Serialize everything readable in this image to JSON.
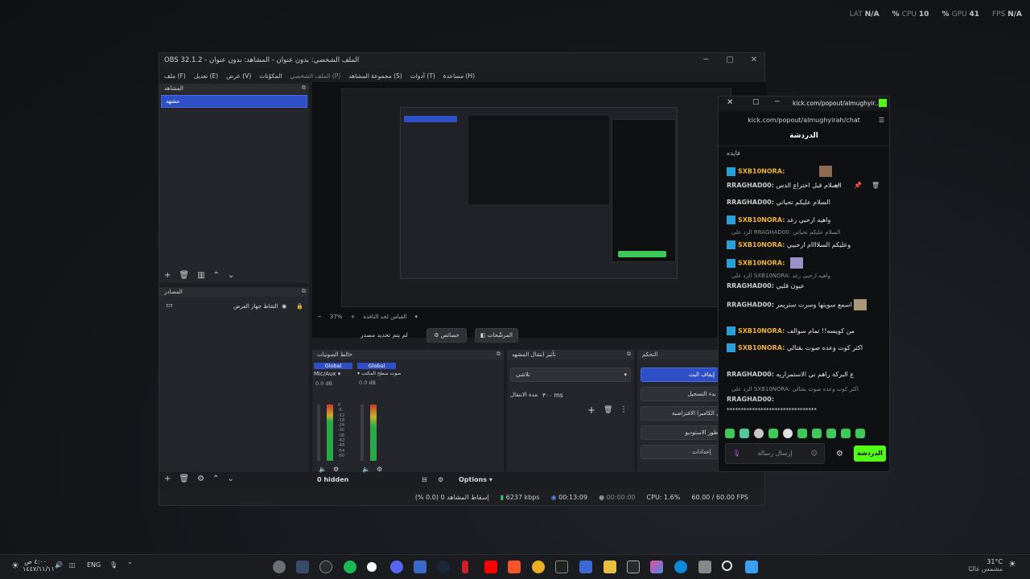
{
  "overlay": {
    "fps": {
      "label": "FPS",
      "value": "N/A"
    },
    "gpu": {
      "label": "GPU",
      "value": "41 %"
    },
    "cpu": {
      "label": "CPU",
      "value": "10 %"
    },
    "lat": {
      "label": "LAT",
      "value": "N/A"
    }
  },
  "obs": {
    "title": "OBS 32.1.2 - الملف الشخصي: بدون عنوان - المشاهد: بدون عنوان",
    "menu": [
      "ملف (F)",
      "تعديل (E)",
      "عرض (V)",
      "المكوّنات",
      "الملف الشخصي (P)",
      "مجموعة المشاهد (S)",
      "أدوات (T)",
      "مساعدة (H)"
    ],
    "scenes": {
      "header": "المشاهد",
      "selected": "مشهد"
    },
    "sources": {
      "header": "المصادر",
      "item": "التقاط جهاز العرض"
    },
    "zoom": "37%",
    "zoom_mode": "القياس لحد النافذة",
    "no_source": "لم يتم تحديد مصدر",
    "properties": "خصائص",
    "filters": "المرشّحات",
    "audio": {
      "header": "خالط الصوتيات",
      "ch1": {
        "tag": "Global",
        "name": "Mic/Aux",
        "db": "0.0 dB"
      },
      "ch2": {
        "tag": "Global",
        "name": "صوت سطح المكتب",
        "db": "0.0 dB"
      },
      "scale": [
        "0",
        "-6",
        "-12",
        "-18",
        "-24",
        "-30",
        "-36",
        "-42",
        "-48",
        "-54",
        "-60"
      ]
    },
    "transitions": {
      "header": "تأثير انتقال المشهد",
      "type": "تلاشي",
      "duration_label": "مدة الانتقال",
      "duration": "٣٠٠ ms"
    },
    "controls": {
      "header": "التحكم",
      "buttons": [
        "إيقاف البث",
        "بدء التسجيل",
        "تشغيل الكاميرا الافتراضية",
        "طور الاستوديو",
        "إعدادات"
      ]
    },
    "hidden": "0 hidden",
    "options": "Options",
    "status": {
      "dropped": "إسقاط المشاهد 0 (0.0 %)",
      "kbps": "6237 kbps",
      "time": "00:13:09",
      "rec": "00:00:00",
      "cpu": "CPU: 1.6%",
      "fps": "60.00 / 60.00 FPS"
    }
  },
  "chat": {
    "url_title": "kick.com/popout/almughyir...",
    "url": "kick.com/popout/almughyirah/chat",
    "header": "الدردشة",
    "first": "فايده",
    "messages": [
      {
        "user": "SXB10NORA:",
        "text": "",
        "kind": "sub"
      },
      {
        "user": "RRAGHAD00:",
        "text": "السلام قبل اختراع الدس",
        "kind": "plain"
      },
      {
        "user": "RRAGHAD00:",
        "text": "السلام عليكم تحياتي",
        "kind": "plain"
      },
      {
        "user": "SXB10NORA:",
        "text": "واهيه ارحبي رغد",
        "kind": "sub"
      },
      {
        "reply": "الرد على RRAGHAD00: السلام عليكم تحياتي"
      },
      {
        "user": "SXB10NORA:",
        "text": "وعليكم السلاااام ارحبيي",
        "kind": "sub"
      },
      {
        "user": "SXB10NORA:",
        "text": "",
        "kind": "sub"
      },
      {
        "reply": "الرد على SXB10NORA: واهيه ارحبي رغد"
      },
      {
        "user": "RRAGHAD00:",
        "text": "عيون قلبي",
        "kind": "plain"
      },
      {
        "user": "RRAGHAD00:",
        "text": "اسمع سويتها وسرت ستريمر",
        "kind": "plain"
      },
      {
        "user": "SXB10NORA:",
        "text": "من كويسه!! تمام سوالف",
        "kind": "sub"
      },
      {
        "user": "SXB10NORA:",
        "text": "اكثر كوت وعده صوت بقتالي",
        "kind": "sub"
      },
      {
        "user": "RRAGHAD00:",
        "text": "ع البركة راهم ني الاستمراريه",
        "kind": "plain"
      },
      {
        "reply": "الرد على SXB10NORA: اكثر كوت وعده صوت بقتالي"
      },
      {
        "user": "RRAGHAD00:",
        "text": "",
        "kind": "plain"
      },
      {
        "text": "********************************",
        "kind": "stars"
      }
    ],
    "input_placeholder": "إرسال رسالة",
    "send": "الدردشة"
  },
  "taskbar": {
    "lang": "ENG",
    "time": "٤:٠٠ ص",
    "date": "١٤٤٧/١١/١١",
    "weather_temp": "31°C",
    "weather_desc": "مشمس غالبًا"
  },
  "colors": {
    "accent": "#2f4fc4",
    "kick_green": "#53fc18",
    "username": "#f0b23a"
  }
}
